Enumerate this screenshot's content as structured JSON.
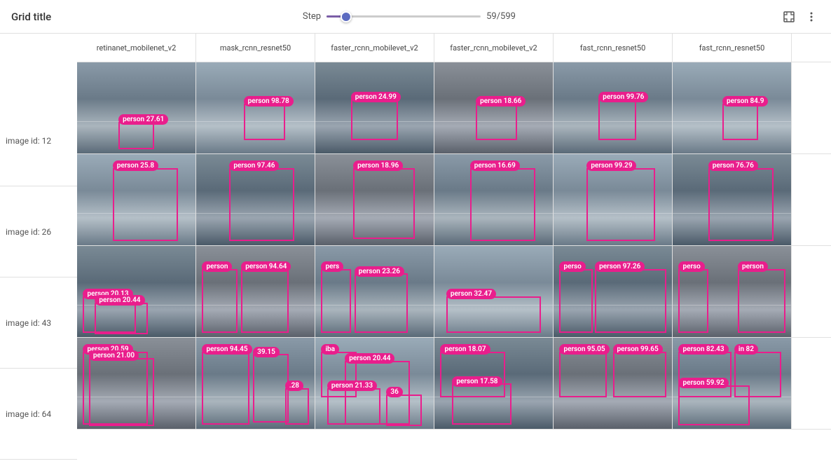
{
  "header": {
    "title": "Grid title",
    "step_label": "Step",
    "step_value": "59/599",
    "step_current": 59,
    "step_max": 599,
    "expand_icon": "⤢",
    "more_icon": "⋮"
  },
  "columns": [
    {
      "id": "col-0",
      "label": "retinanet_mobilenet_v2"
    },
    {
      "id": "col-1",
      "label": "mask_rcnn_resnet50"
    },
    {
      "id": "col-2",
      "label": "faster_rcnn_mobilevet_v2"
    },
    {
      "id": "col-3",
      "label": "faster_rcnn_mobilevet_v2"
    },
    {
      "id": "col-4",
      "label": "fast_rcnn_resnet50"
    },
    {
      "id": "col-5",
      "label": "fast_rcnn_resnet50"
    }
  ],
  "rows": [
    {
      "id": "row-0",
      "label": "image id: 12",
      "cells": [
        {
          "detections": [
            {
              "label": "person 27.61",
              "top": "65%",
              "left": "35%",
              "bw": "30%",
              "bh": "30%"
            }
          ]
        },
        {
          "detections": [
            {
              "label": "person 98.78",
              "top": "45%",
              "left": "40%",
              "bw": "35%",
              "bh": "40%"
            }
          ]
        },
        {
          "detections": [
            {
              "label": "person 24.99",
              "top": "40%",
              "left": "30%",
              "bw": "40%",
              "bh": "45%"
            }
          ]
        },
        {
          "detections": [
            {
              "label": "person 18.66",
              "top": "45%",
              "left": "35%",
              "bw": "35%",
              "bh": "40%"
            }
          ]
        },
        {
          "detections": [
            {
              "label": "person 99.76",
              "top": "40%",
              "left": "38%",
              "bw": "32%",
              "bh": "45%"
            }
          ]
        },
        {
          "detections": [
            {
              "label": "person 84.9",
              "top": "45%",
              "left": "42%",
              "bw": "30%",
              "bh": "40%"
            }
          ]
        }
      ]
    },
    {
      "id": "row-1",
      "label": "image id: 26",
      "cells": [
        {
          "detections": [
            {
              "label": "person 25.8",
              "top": "15%",
              "left": "30%",
              "bw": "55%",
              "bh": "80%"
            }
          ]
        },
        {
          "detections": [
            {
              "label": "person 97.46",
              "top": "15%",
              "left": "28%",
              "bw": "55%",
              "bh": "80%"
            }
          ]
        },
        {
          "detections": [
            {
              "label": "person 18.96",
              "top": "15%",
              "left": "32%",
              "bw": "52%",
              "bh": "78%"
            }
          ]
        },
        {
          "detections": [
            {
              "label": "person 16.69",
              "top": "15%",
              "left": "30%",
              "bw": "55%",
              "bh": "80%"
            }
          ]
        },
        {
          "detections": [
            {
              "label": "person 99.29",
              "top": "15%",
              "left": "28%",
              "bw": "58%",
              "bh": "80%"
            }
          ]
        },
        {
          "detections": [
            {
              "label": "person 76.76",
              "top": "15%",
              "left": "30%",
              "bw": "55%",
              "bh": "80%"
            }
          ]
        }
      ]
    },
    {
      "id": "row-2",
      "label": "image id: 43",
      "cells": [
        {
          "detections": [
            {
              "label": "person 20.13",
              "top": "55%",
              "left": "5%",
              "bw": "45%",
              "bh": "40%"
            },
            {
              "label": "person 20.44",
              "top": "62%",
              "left": "15%",
              "bw": "45%",
              "bh": "35%"
            }
          ]
        },
        {
          "detections": [
            {
              "label": "person",
              "top": "25%",
              "left": "5%",
              "bw": "30%",
              "bh": "70%"
            },
            {
              "label": "person 94.64",
              "top": "25%",
              "left": "38%",
              "bw": "40%",
              "bh": "70%"
            }
          ]
        },
        {
          "detections": [
            {
              "label": "pers",
              "top": "25%",
              "left": "5%",
              "bw": "25%",
              "bh": "70%"
            },
            {
              "label": "person 23.26",
              "top": "30%",
              "left": "33%",
              "bw": "45%",
              "bh": "65%"
            }
          ]
        },
        {
          "detections": [
            {
              "label": "person 32.47",
              "top": "55%",
              "left": "10%",
              "bw": "80%",
              "bh": "40%"
            }
          ]
        },
        {
          "detections": [
            {
              "label": "perso",
              "top": "25%",
              "left": "5%",
              "bw": "28%",
              "bh": "70%"
            },
            {
              "label": "person 97.26",
              "top": "25%",
              "left": "35%",
              "bw": "60%",
              "bh": "70%"
            }
          ]
        },
        {
          "detections": [
            {
              "label": "perso",
              "top": "25%",
              "left": "5%",
              "bw": "25%",
              "bh": "70%"
            },
            {
              "label": "person",
              "top": "25%",
              "left": "55%",
              "bw": "40%",
              "bh": "70%"
            }
          ]
        }
      ]
    },
    {
      "id": "row-3",
      "label": "image id: 64",
      "cells": [
        {
          "detections": [
            {
              "label": "person 20.59",
              "top": "15%",
              "left": "5%",
              "bw": "55%",
              "bh": "80%"
            },
            {
              "label": "person 21.00",
              "top": "22%",
              "left": "10%",
              "bw": "55%",
              "bh": "75%"
            }
          ]
        },
        {
          "detections": [
            {
              "label": "person 94.45",
              "top": "15%",
              "left": "5%",
              "bw": "40%",
              "bh": "80%"
            },
            {
              "label": "39.15",
              "top": "18%",
              "left": "48%",
              "bw": "30%",
              "bh": "75%"
            },
            {
              "label": ".28",
              "top": "55%",
              "left": "75%",
              "bw": "20%",
              "bh": "40%"
            }
          ]
        },
        {
          "detections": [
            {
              "label": "iba",
              "top": "15%",
              "left": "5%",
              "bw": "30%",
              "bh": "50%"
            },
            {
              "label": "person 20.44",
              "top": "25%",
              "left": "25%",
              "bw": "55%",
              "bh": "70%"
            },
            {
              "label": "person 21.33",
              "top": "55%",
              "left": "10%",
              "bw": "45%",
              "bh": "40%"
            },
            {
              "label": "36",
              "top": "62%",
              "left": "60%",
              "bw": "30%",
              "bh": "35%"
            }
          ]
        },
        {
          "detections": [
            {
              "label": "person 18.07",
              "top": "15%",
              "left": "5%",
              "bw": "55%",
              "bh": "50%"
            },
            {
              "label": "person 17.58",
              "top": "50%",
              "left": "15%",
              "bw": "50%",
              "bh": "45%"
            }
          ]
        },
        {
          "detections": [
            {
              "label": "person 95.05",
              "top": "15%",
              "left": "5%",
              "bw": "40%",
              "bh": "50%"
            },
            {
              "label": "person 99.65",
              "top": "15%",
              "left": "50%",
              "bw": "45%",
              "bh": "50%"
            }
          ]
        },
        {
          "detections": [
            {
              "label": "person 82.43",
              "top": "15%",
              "left": "5%",
              "bw": "45%",
              "bh": "50%"
            },
            {
              "label": "in 82",
              "top": "15%",
              "left": "52%",
              "bw": "40%",
              "bh": "50%"
            },
            {
              "label": "person 59.92",
              "top": "52%",
              "left": "5%",
              "bw": "60%",
              "bh": "44%"
            }
          ]
        }
      ]
    }
  ]
}
